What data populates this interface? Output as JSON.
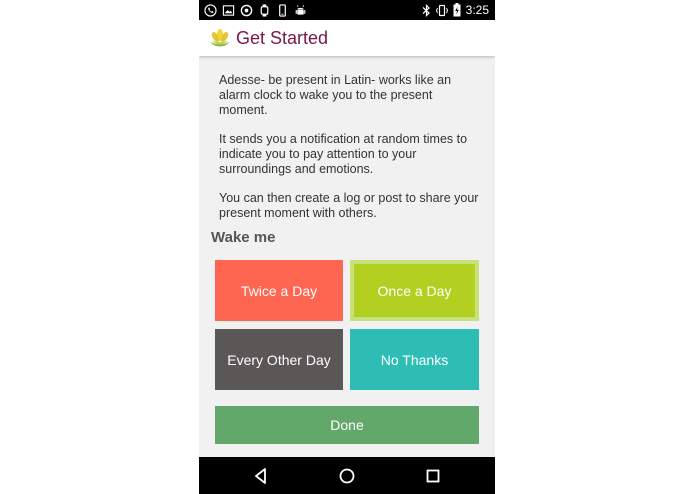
{
  "status_bar": {
    "time": "3:25",
    "left_icons": [
      "phone-icon",
      "image-icon",
      "voicemail-icon",
      "watch-icon",
      "mobile-device-icon",
      "android-icon"
    ],
    "right_icons": [
      "bluetooth-icon",
      "vibrate-icon",
      "battery-charging-icon"
    ]
  },
  "app_bar": {
    "title": "Get Started",
    "logo": "lotus-icon"
  },
  "intro": {
    "p1": "Adesse- be present in Latin- works like an alarm clock to wake you to the present moment.",
    "p2": "It sends you a notification at random times to indicate you to pay attention to your surroundings and emotions.",
    "p3": "You can then create a log or post to share your present moment with others."
  },
  "wake": {
    "label": "Wake me",
    "options": {
      "twice": "Twice a Day",
      "once": "Once a Day",
      "every_other": "Every Other Day",
      "no_thanks": "No Thanks"
    },
    "selected": "Once a Day"
  },
  "done_label": "Done",
  "nav": {
    "back": "back-icon",
    "home": "home-icon",
    "recents": "recents-icon"
  },
  "colors": {
    "title": "#7b1747",
    "twice": "#ff6652",
    "once": "#b2cf22",
    "every_other": "#5a5757",
    "no_thanks": "#2dbdb5",
    "done": "#61a86a"
  }
}
